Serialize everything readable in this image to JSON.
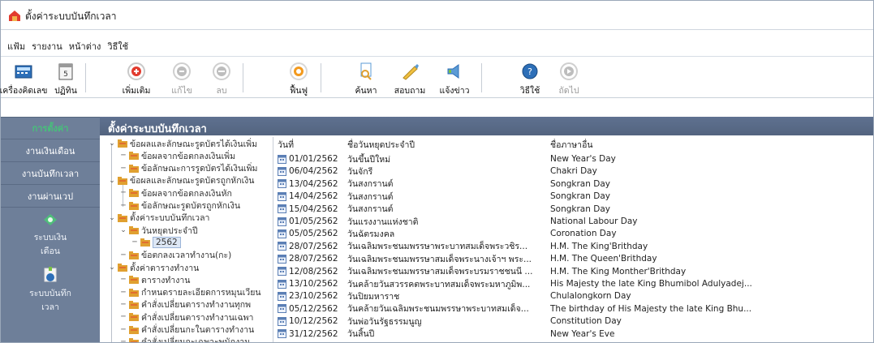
{
  "window": {
    "title": "ตั้งค่าระบบบันทึกเวลา"
  },
  "menu": [
    "แฟ้ม",
    "รายงาน",
    "หน้าต่าง",
    "วิธีใช้"
  ],
  "toolbar": [
    {
      "label": "เครื่องคิดเลข",
      "icon": "calculator-icon",
      "enabled": true
    },
    {
      "label": "ปฏิทิน",
      "icon": "calendar-icon",
      "enabled": true
    },
    {
      "label": "เพิ่มเติม",
      "icon": "add-icon",
      "enabled": true
    },
    {
      "label": "แก้ไข",
      "icon": "edit-icon",
      "enabled": false
    },
    {
      "label": "ลบ",
      "icon": "delete-icon",
      "enabled": false
    },
    {
      "label": "ฟื้นฟู",
      "icon": "refresh-icon",
      "enabled": true
    },
    {
      "label": "ค้นหา",
      "icon": "search-icon",
      "enabled": true
    },
    {
      "label": "สอบถาม",
      "icon": "query-icon",
      "enabled": true
    },
    {
      "label": "แจ้งข่าว",
      "icon": "announce-icon",
      "enabled": true
    },
    {
      "label": "วิธีใช้",
      "icon": "help-icon",
      "enabled": true
    },
    {
      "label": "ถัดไป",
      "icon": "next-icon",
      "enabled": false
    }
  ],
  "sidebar": {
    "items": [
      {
        "label": "การตั้งค่า",
        "active": true
      },
      {
        "label": "งานเงินเดือน",
        "active": false
      },
      {
        "label": "งานบันทึกเวลา",
        "active": false
      },
      {
        "label": "งานผ่านเวป",
        "active": false
      }
    ],
    "modules": [
      {
        "label": "ระบบเงินเดือน",
        "icon": "payroll-module-icon"
      },
      {
        "label": "ระบบบันทึกเวลา",
        "icon": "timeattendance-module-icon"
      }
    ]
  },
  "panel": {
    "title": "ตั้งค่าระบบบันทึกเวลา"
  },
  "tree": [
    {
      "label": "ข้อผลและลักษณะรูดบัตรได้เงินเพิ่ม",
      "level": 0,
      "expanded": true
    },
    {
      "label": "ข้อผลจากข้อตกลงเงินเพิ่ม",
      "level": 1
    },
    {
      "label": "ข้อลักษณะการรูดบัตรได้เงินเพิ่ม",
      "level": 1
    },
    {
      "label": "ข้อผลและลักษณะรูดบัตรถูกหักเงิน",
      "level": 0,
      "expanded": true
    },
    {
      "label": "ข้อผลจากข้อตกลงเงินหัก",
      "level": 1
    },
    {
      "label": "ข้อลักษณะรูดบัตรถูกหักเงิน",
      "level": 1
    },
    {
      "label": "ตั้งค่าระบบบันทึกเวลา",
      "level": 0,
      "expanded": true
    },
    {
      "label": "วันหยุดประจำปี",
      "level": 1,
      "expanded": true
    },
    {
      "label": "2562",
      "level": 2,
      "selected": true
    },
    {
      "label": "ข้อตกลงเวลาทำงาน(กะ)",
      "level": 1
    },
    {
      "label": "ตั้งค่าตารางทำงาน",
      "level": 0,
      "expanded": true
    },
    {
      "label": "ตารางทำงาน",
      "level": 1
    },
    {
      "label": "กำหนดรายละเอียดการหมุนเวียน",
      "level": 1
    },
    {
      "label": "คำสั่งเปลี่ยนตารางทำงานทุกพ",
      "level": 1
    },
    {
      "label": "คำสั่งเปลี่ยนตารางทำงานเฉพา",
      "level": 1
    },
    {
      "label": "คำสั่งเปลี่ยนกะในตารางทำงาน",
      "level": 1
    },
    {
      "label": "คำสั่งเปลี่ยนกะเฉพาะพนักงาน",
      "level": 1
    }
  ],
  "list": {
    "columns": [
      "วันที่",
      "ชื่อวันหยุดประจำปี",
      "ชื่อภาษาอื่น"
    ],
    "rows": [
      [
        "01/01/2562",
        "วันขึ้นปีใหม่",
        "New Year's Day"
      ],
      [
        "06/04/2562",
        "วันจักรี",
        "Chakri Day"
      ],
      [
        "13/04/2562",
        "วันสงกรานต์",
        "Songkran Day"
      ],
      [
        "14/04/2562",
        "วันสงกรานต์",
        "Songkran Day"
      ],
      [
        "15/04/2562",
        "วันสงกรานต์",
        "Songkran Day"
      ],
      [
        "01/05/2562",
        "วันแรงงานแห่งชาติ",
        "National Labour Day"
      ],
      [
        "05/05/2562",
        "วันฉัตรมงคล",
        "Coronation Day"
      ],
      [
        "28/07/2562",
        "วันเฉลิมพระชนมพรรษาพระบาทสมเด็จพระวชิร...",
        "H.M. The King'Brithday"
      ],
      [
        "28/07/2562",
        "วันเฉลิมพระชนมพรรษาสมเด็จพระนางเจ้าฯ พระ...",
        "H.M. The Queen'Brithday"
      ],
      [
        "12/08/2562",
        "วันเฉลิมพระชนมพรรษาสมเด็จพระบรมราชชนนี ...",
        "H.M. The King Monther'Brithday"
      ],
      [
        "13/10/2562",
        "วันคล้ายวันสวรรคตพระบาทสมเด็จพระมหาภูมิพ...",
        "His Majesty the late King Bhumibol Adulyadej..."
      ],
      [
        "23/10/2562",
        "วันปิยมหาราช",
        "Chulalongkorn Day"
      ],
      [
        "05/12/2562",
        "วันคล้ายวันเฉลิมพระชนมพรรษาพระบาทสมเด็จ...",
        "The birthday of His Majesty the late King Bhu..."
      ],
      [
        "10/12/2562",
        "วันพ่อวันรัฐธรรมนูญ",
        "Constitution Day"
      ],
      [
        "31/12/2562",
        "วันสิ้นปี",
        "New Year's Eve"
      ]
    ]
  },
  "colors": {
    "sidebar_bg": "#6e7f99",
    "active_text": "#47c07a",
    "header_bg": "#5f7190",
    "folder": "#e0a030"
  }
}
